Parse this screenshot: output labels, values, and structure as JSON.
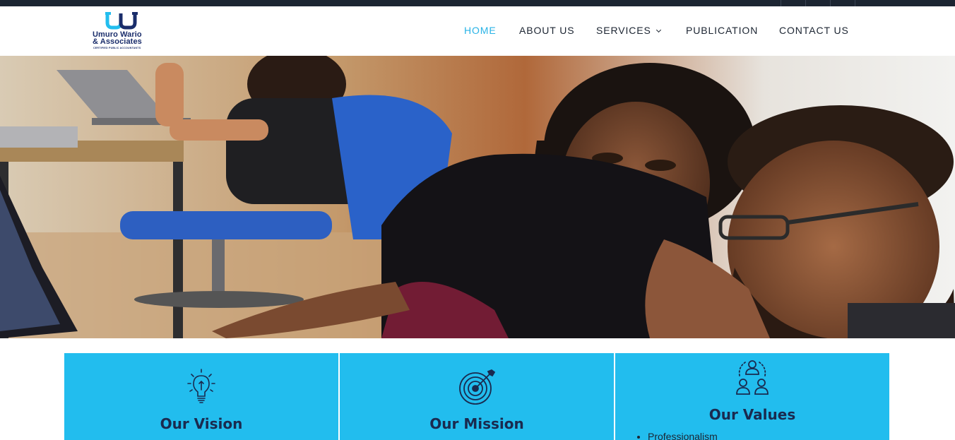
{
  "brand": {
    "name_line1": "Umuro Wario",
    "name_line2": "& Associates",
    "tagline": "CERTIFIED PUBLIC ACCOUNTANTS",
    "primary_color": "#22bdee",
    "dark_color": "#1a2d6b"
  },
  "nav": {
    "items": [
      {
        "label": "HOME",
        "active": true
      },
      {
        "label": "ABOUT US",
        "active": false
      },
      {
        "label": "SERVICES",
        "active": false,
        "has_dropdown": true
      },
      {
        "label": "PUBLICATION",
        "active": false
      },
      {
        "label": "CONTACT US",
        "active": false
      }
    ]
  },
  "hero": {
    "image": "team-working-at-computer-photo"
  },
  "cards": [
    {
      "title": "Our Vision",
      "icon": "lightbulb-icon"
    },
    {
      "title": "Our Mission",
      "icon": "target-icon"
    },
    {
      "title": "Our Values",
      "icon": "team-icon",
      "items": [
        "Professionalism"
      ]
    }
  ]
}
